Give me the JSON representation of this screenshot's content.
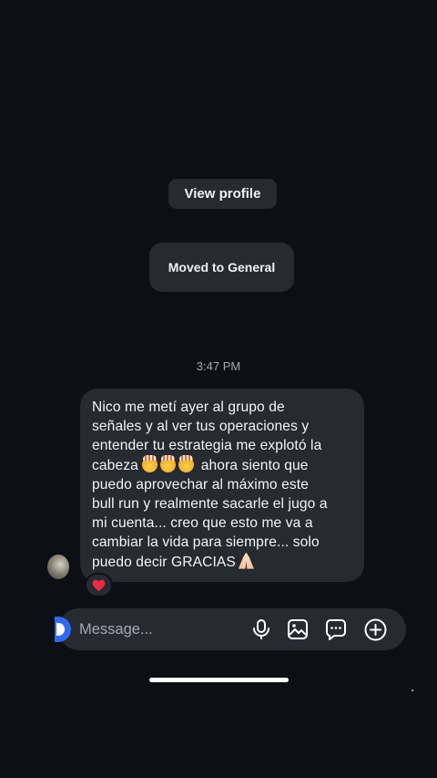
{
  "header": {
    "view_profile_label": "View profile",
    "moved_label": "Moved to General"
  },
  "thread": {
    "timestamp": "3:47 PM",
    "message": {
      "lines": [
        "Nico me metí ayer al grupo de",
        "señales y al ver tus operaciones y",
        "entender tu estrategia me explotó la",
        "cabeza",
        " ahora siento que",
        "puedo aprovechar al máximo este",
        "bull run y realmente sacarle el jugo a",
        "mi cuenta... creo que esto me va a",
        "cambiar la vida para siempre... solo",
        "puedo decir GRACIAS"
      ],
      "emojis": [
        "exploding-head-emoji",
        "exploding-head-emoji",
        "exploding-head-emoji",
        "folded-hands-emoji"
      ],
      "reaction": "heart-reaction"
    }
  },
  "composer": {
    "placeholder": "Message...",
    "icons": [
      "microphone-icon",
      "gallery-icon",
      "sticker-chat-icon",
      "add-icon"
    ]
  },
  "colors": {
    "background": "#0c0f14",
    "bubble": "#262a31",
    "accent": "#2f6bf2",
    "heart": "#ee2a45"
  }
}
